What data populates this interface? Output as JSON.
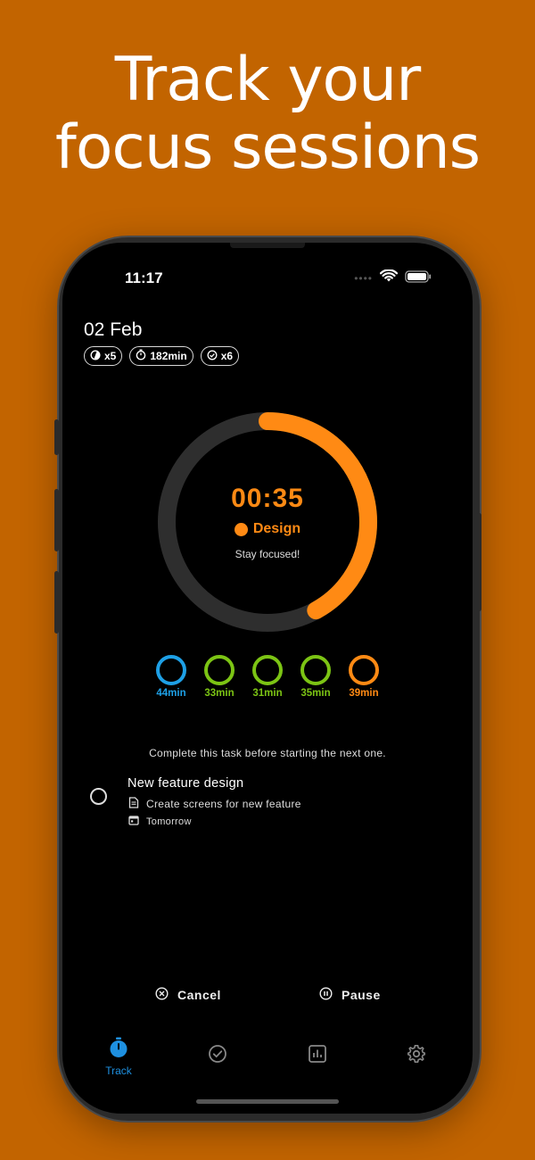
{
  "headline": {
    "line1": "Track your",
    "line2": "focus sessions"
  },
  "status_bar": {
    "time": "11:17",
    "dots": "••••"
  },
  "header": {
    "date": "02 Feb",
    "chips": [
      {
        "icon": "half-moon-icon",
        "label": "x5"
      },
      {
        "icon": "stopwatch-icon",
        "label": "182min"
      },
      {
        "icon": "check-circle-icon",
        "label": "x6"
      }
    ]
  },
  "timer": {
    "time": "00:35",
    "category": "Design",
    "category_color": "#ff8a14",
    "message": "Stay focused!",
    "progress": 0.42
  },
  "sessions": [
    {
      "label": "44min",
      "color": "#1ea0e6"
    },
    {
      "label": "33min",
      "color": "#7cc414"
    },
    {
      "label": "31min",
      "color": "#7cc414"
    },
    {
      "label": "35min",
      "color": "#7cc414"
    },
    {
      "label": "39min",
      "color": "#ff8a14"
    }
  ],
  "notice": "Complete this task before starting the next one.",
  "task": {
    "title": "New feature design",
    "description": "Create screens for new feature",
    "due": "Tomorrow"
  },
  "actions": {
    "cancel_label": "Cancel",
    "pause_label": "Pause"
  },
  "tabs": [
    {
      "icon": "stopwatch-icon",
      "label": "Track",
      "active": true
    },
    {
      "icon": "check-circle-icon",
      "label": "",
      "active": false
    },
    {
      "icon": "chart-icon",
      "label": "",
      "active": false
    },
    {
      "icon": "gear-icon",
      "label": "",
      "active": false
    }
  ],
  "colors": {
    "background": "#c26400",
    "accent": "#ff8a14",
    "active_tab": "#1e90e0",
    "track": "#2e2e2e"
  }
}
